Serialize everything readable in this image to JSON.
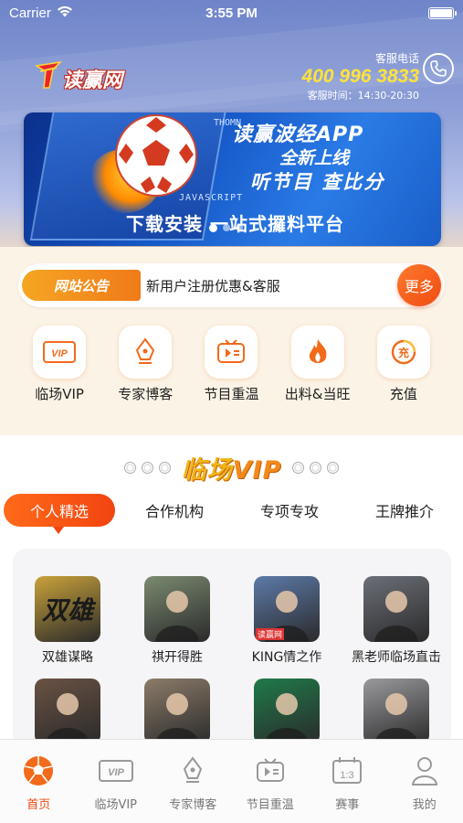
{
  "status_bar": {
    "carrier": "Carrier",
    "time": "3:55 PM"
  },
  "header": {
    "logo_text": "读赢网",
    "contact_label": "客服电话",
    "phone": "400 996 3833",
    "hours": "客服时间：14:30-20:30"
  },
  "banner": {
    "title": "读赢波经APP",
    "line2": "全新上线",
    "line3": "听节目 查比分",
    "line4": "下载安装 一站式攞料平台",
    "code_a": "THOMN",
    "code_b": "JAVASCRIPT",
    "page_count": 3,
    "active_page": 1
  },
  "notice": {
    "tag": "网站公告",
    "text": "新用户注册优惠&客服",
    "more": "更多"
  },
  "quick_nav": [
    {
      "label": "临场VIP",
      "icon": "vip-icon"
    },
    {
      "label": "专家博客",
      "icon": "pen-icon"
    },
    {
      "label": "节目重温",
      "icon": "replay-icon"
    },
    {
      "label": "出料&当旺",
      "icon": "fire-icon"
    },
    {
      "label": "充值",
      "icon": "recharge-icon"
    }
  ],
  "vip_section": {
    "title_a": "临场",
    "title_b": "VIP",
    "tabs": [
      "个人精选",
      "合作机构",
      "专项专攻",
      "王牌推介"
    ],
    "active_tab": 0,
    "experts": [
      {
        "name": "双雄谋略",
        "avatar_text": "双雄",
        "color": "#c9a23a"
      },
      {
        "name": "祺开得胜",
        "avatar_text": "",
        "color": "#7a8a70"
      },
      {
        "name": "KING情之作",
        "avatar_text": "读赢网",
        "color": "#5d7aa8"
      },
      {
        "name": "黑老师临场直击",
        "avatar_text": "",
        "color": "#6c6f78"
      },
      {
        "name": "",
        "avatar_text": "",
        "color": "#6a5244"
      },
      {
        "name": "",
        "avatar_text": "",
        "color": "#8c7c6a"
      },
      {
        "name": "",
        "avatar_text": "",
        "color": "#1f7a4a"
      },
      {
        "name": "",
        "avatar_text": "",
        "color": "#9a9a9e"
      }
    ]
  },
  "tab_bar": [
    {
      "label": "首页",
      "icon": "soccer-ball-icon",
      "active": true
    },
    {
      "label": "临场VIP",
      "icon": "vip-icon",
      "active": false
    },
    {
      "label": "专家博客",
      "icon": "pen-icon",
      "active": false
    },
    {
      "label": "节目重温",
      "icon": "replay-icon",
      "active": false
    },
    {
      "label": "赛事",
      "icon": "scoreboard-icon",
      "active": false
    },
    {
      "label": "我的",
      "icon": "user-icon",
      "active": false
    }
  ],
  "colors": {
    "accent": "#f04a10",
    "gold": "#ffe23d",
    "banner_blue": "#1557c6"
  }
}
